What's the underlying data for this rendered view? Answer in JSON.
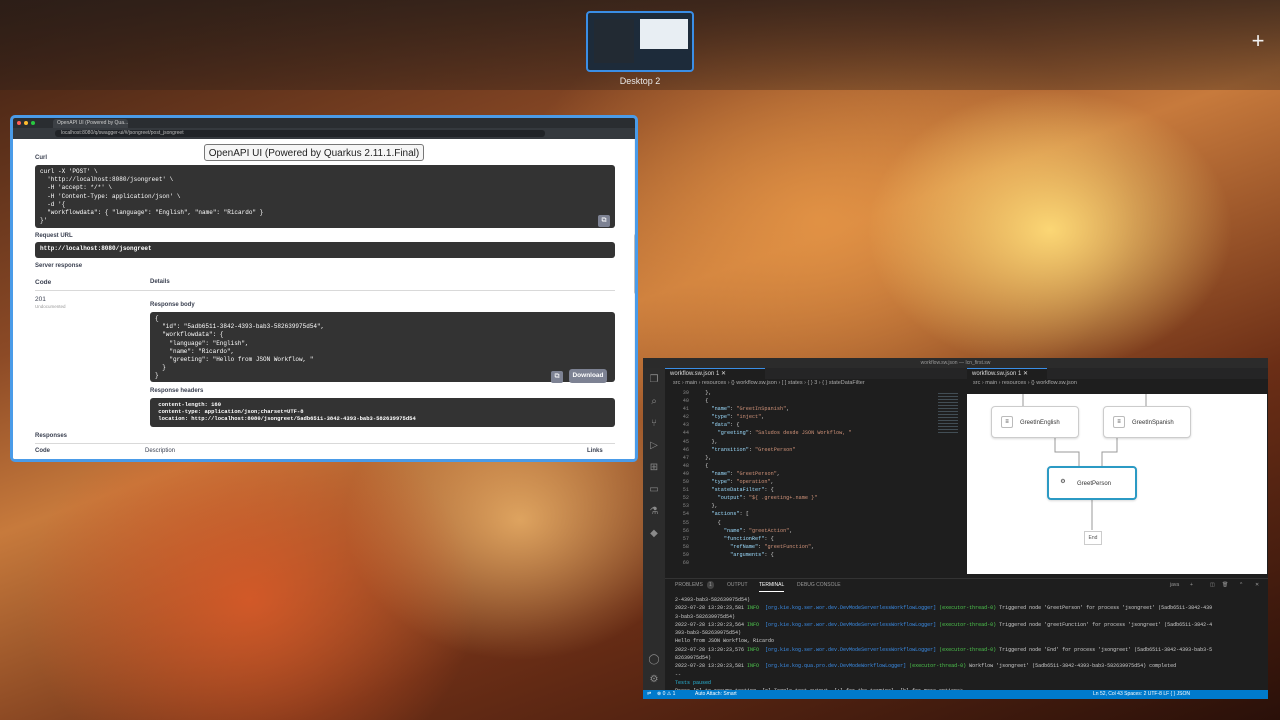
{
  "desktop": {
    "thumbnail_label": "Desktop 2",
    "add_label": "+"
  },
  "browser": {
    "tab_title": "OpenAPI UI (Powered by Qua...",
    "url": "localhost:8080/q/swagger-ui/#/jsongreet/post_jsongreet",
    "curl_label": "Curl",
    "curl_code": "curl -X 'POST' \\\n  'http://localhost:8080/jsongreet' \\\n  -H 'accept: */*' \\\n  -H 'Content-Type: application/json' \\\n  -d '{\n  \"workflowdata\": { \"language\": \"English\", \"name\": \"Ricardo\" }\n}'",
    "request_url_label": "Request URL",
    "request_url": "http://localhost:8080/jsongreet",
    "server_response_label": "Server response",
    "code_header": "Code",
    "details_header": "Details",
    "status_code": "201",
    "status_note": "Undocumented",
    "response_body_label": "Response body",
    "response_body": "{\n  \"id\": \"5adb6511-3842-4393-bab3-582639975d54\",\n  \"workflowdata\": {\n    \"language\": \"English\",\n    \"name\": \"Ricardo\",\n    \"greeting\": \"Hello from JSON Workflow, \"\n  }\n}",
    "download_label": "Download",
    "response_headers_label": "Response headers",
    "response_headers": " content-length: 160\n content-type: application/json;charset=UTF-8\n location: http://localhost:8080/jsongreet/5adb6511-3842-4393-bab3-582639975d54",
    "responses_label": "Responses",
    "code_col": "Code",
    "description_col": "Description",
    "links_col": "Links",
    "tooltip": "OpenAPI UI (Powered by Quarkus 2.11.1.Final)"
  },
  "vscode": {
    "title": "workflow.sw.json — Icn_first.sw",
    "editor_tab": "workflow.sw.json 1",
    "diagram_tab": "workflow.sw.json 1",
    "breadcrumb_left": "src › main › resources › {} workflow.sw.json › [ ] states › { } 3 › { } stateDataFilter",
    "breadcrumb_right": "src › main › resources › {} workflow.sw.json",
    "line_numbers": [
      "39",
      "40",
      "41",
      "42",
      "43",
      "44",
      "45",
      "46",
      "47",
      "48",
      "49",
      "50",
      "51",
      "52",
      "53",
      "54",
      "55",
      "56",
      "57",
      "58",
      "59",
      "60"
    ],
    "code_lines": [
      "  },",
      "  {",
      "    \"name\": \"GreetInSpanish\",",
      "    \"type\": \"inject\",",
      "    \"data\": {",
      "      \"greeting\": \"Saludos desde JSON Workflow, \"",
      "    },",
      "    \"transition\": \"GreetPerson\"",
      "  },",
      "  {",
      "    \"name\": \"GreetPerson\",",
      "    \"type\": \"operation\",",
      "    \"stateDataFilter\": {",
      "      \"output\": \"${ .greeting+.name }\"",
      "    },",
      "    \"actions\": [",
      "      {",
      "        \"name\": \"greetAction\",",
      "        \"functionRef\": {",
      "          \"refName\": \"greetFunction\",",
      "          \"arguments\": {",
      "            "
    ],
    "nodes": {
      "english": "GreetInEnglish",
      "spanish": "GreetInSpanish",
      "person": "GreetPerson",
      "end": "End"
    },
    "panel_tabs": [
      "PROBLEMS",
      "OUTPUT",
      "TERMINAL",
      "DEBUG CONSOLE"
    ],
    "problems_count": "1",
    "terminal_shell": "java",
    "terminal_lines": [
      "2-4393-bab3-582639975d54)",
      "2022-07-28 13:20:23,581 INFO  [org.kie.kog.ser.wor.dev.DevModeServerlessWorkflowLogger] (executor-thread-0) Triggered node 'GreetPerson' for process 'jsongreet' (5adb6511-3842-439",
      "3-bab3-582639975d54)",
      "2022-07-28 13:20:23,564 INFO  [org.kie.kog.ser.wor.dev.DevModeServerlessWorkflowLogger] (executor-thread-0) Triggered node 'greetFunction' for process 'jsongreet' (5adb6511-3842-4",
      "393-bab3-582639975d54)",
      "Hello from JSON Workflow, Ricardo",
      "2022-07-28 13:20:23,576 INFO  [org.kie.kog.ser.wor.dev.DevModeServerlessWorkflowLogger] (executor-thread-0) Triggered node 'End' for process 'jsongreet' (5adb6511-3842-4393-bab3-5",
      "82639975d54)",
      "2022-07-28 13:20:23,581 INFO  [org.kie.kog.qua.pro.dev.DevModeWorkflowLogger] (executor-thread-0) Workflow 'jsongreet' (5adb6511-3842-4393-bab3-582639975d54) completed",
      "--",
      "Tests paused",
      "Press [r] to resume testing, [o] Toggle test output, [:] for the terminal, [h] for more options>"
    ],
    "status_left": "⊗ 0 ⚠ 1",
    "status_attach": "Auto Attach: Smart",
    "status_right": "Ln 52, Col 43   Spaces: 2   UTF-8   LF   { } JSON"
  },
  "colors": {
    "accent": "#3a8ee6",
    "statusbar": "#007acc",
    "selected_node": "#2b9ac4"
  }
}
